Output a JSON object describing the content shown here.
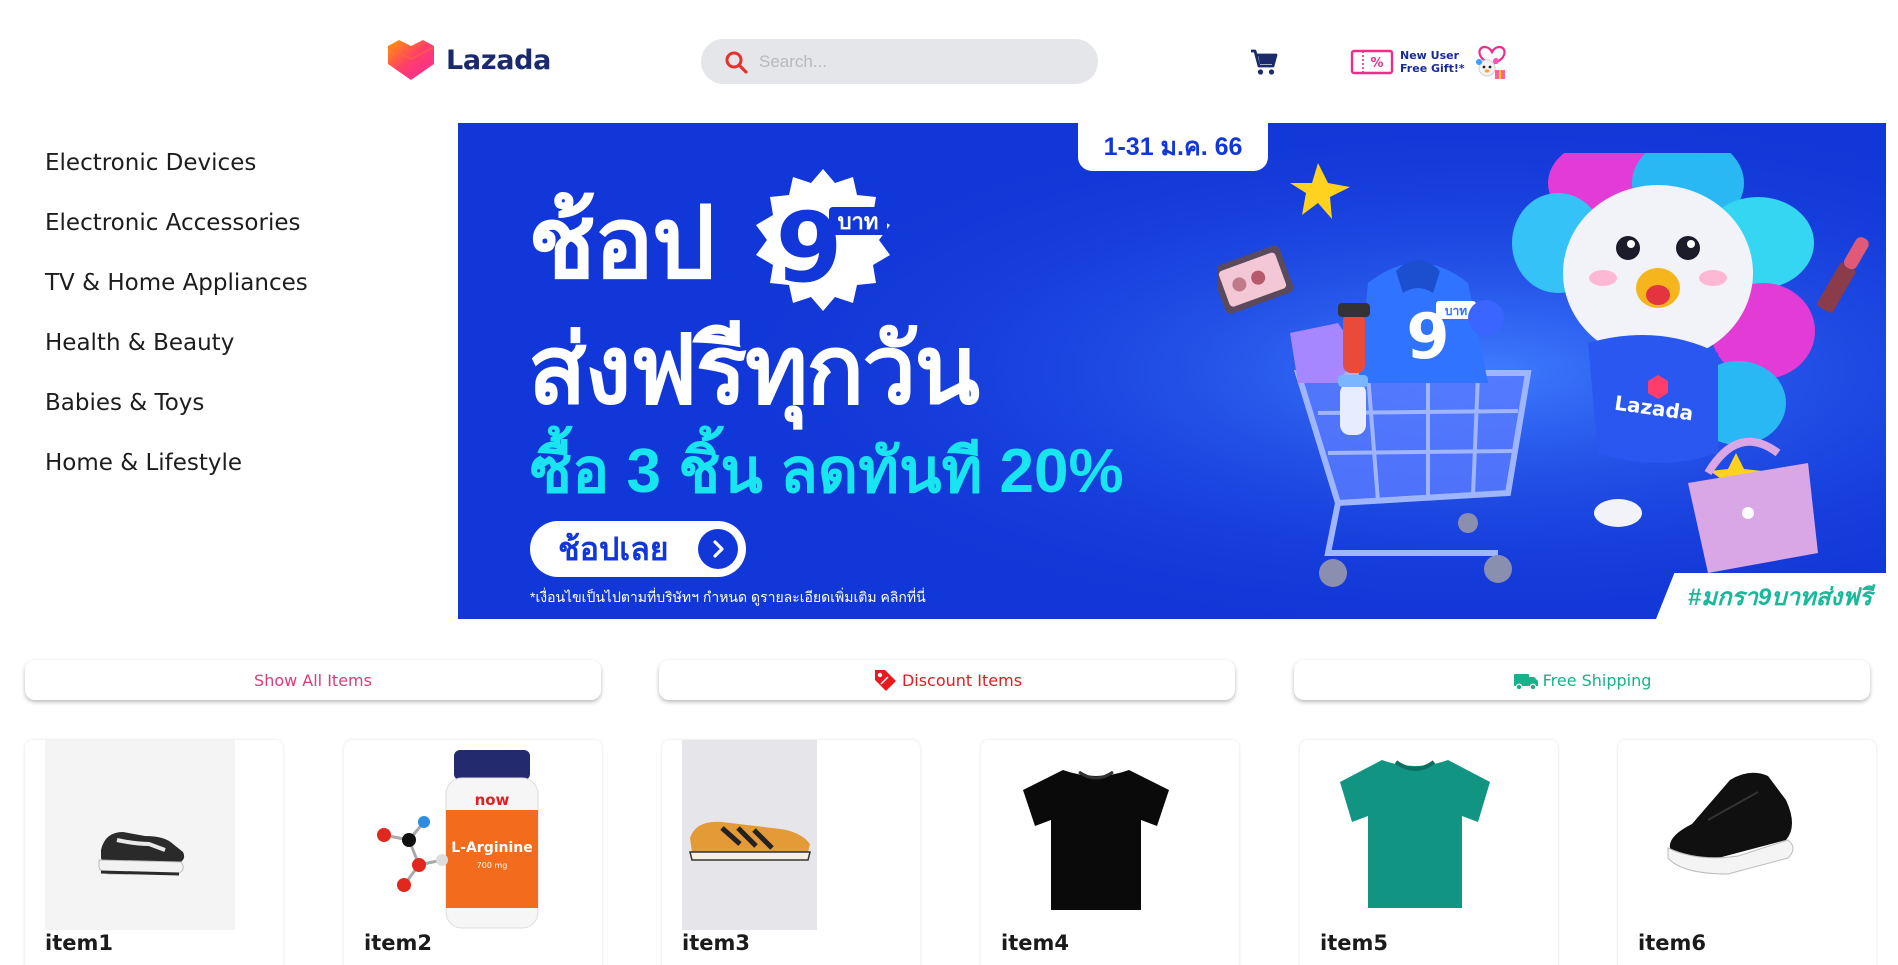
{
  "header": {
    "logo_text": "Lazada",
    "search_placeholder": "Search...",
    "promo_line1": "New User",
    "promo_line2": "Free Gift!*"
  },
  "sidebar": {
    "items": [
      {
        "label": "Electronic Devices"
      },
      {
        "label": "Electronic Accessories"
      },
      {
        "label": "TV & Home Appliances"
      },
      {
        "label": "Health & Beauty"
      },
      {
        "label": "Babies & Toys"
      },
      {
        "label": "Home & Lifestyle"
      }
    ]
  },
  "banner": {
    "date": "1-31 ม.ค. 66",
    "title_line1": "ช้อป",
    "badge_number": "9",
    "badge_unit": "บาท",
    "title_line2": "ส่งฟรีทุกวัน",
    "title_line3": "ซื้อ 3 ชิ้น ลดทันที 20%",
    "cta_label": "ช้อปเลย",
    "note": "*เงื่อนไขเป็นไปตามที่บริษัทฯ กำหนด ดูรายละเอียดเพิ่มเติม คลิกที่นี่",
    "hashtag": "#มกรา9บาทส่งฟรี",
    "art_cart_number": "9",
    "art_cart_unit": "บาท",
    "art_mascot_shirt": "Lazada"
  },
  "filters": {
    "all_label": "Show All Items",
    "discount_label": "Discount Items",
    "shipping_label": "Free Shipping"
  },
  "products": [
    {
      "name": "item1"
    },
    {
      "name": "item2",
      "bottle_brand": "now",
      "bottle_label": "L-Arginine",
      "bottle_dose": "700 mg"
    },
    {
      "name": "item3"
    },
    {
      "name": "item4"
    },
    {
      "name": "item5"
    },
    {
      "name": "item6"
    }
  ],
  "colors": {
    "brand_navy": "#1a2a6c",
    "banner_blue": "#1237d8",
    "banner_cyan": "#19e5f0",
    "pink": "#e03a7a",
    "red": "#e8191f",
    "green": "#17b28a"
  }
}
